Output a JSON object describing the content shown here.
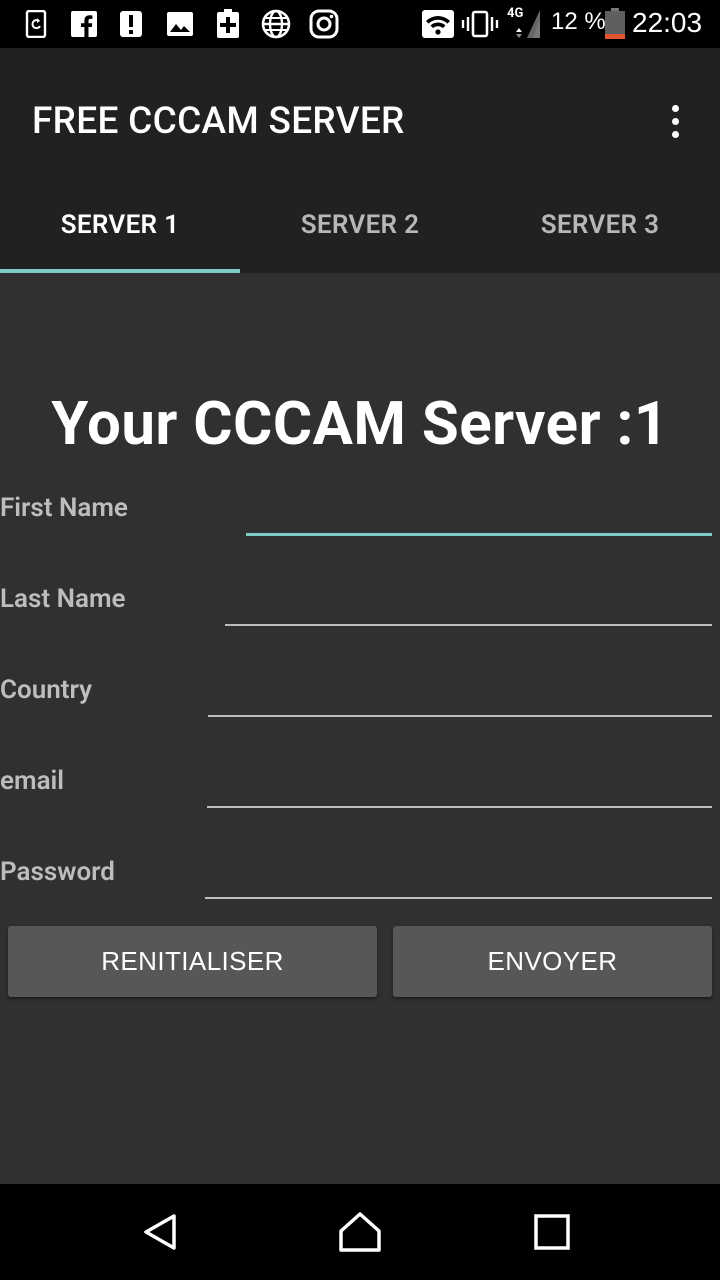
{
  "status_bar": {
    "battery_percent": "12 %",
    "time": "22:03",
    "network_type": "4G",
    "notification_icons": [
      "sync-app-icon",
      "facebook-icon",
      "alert-icon",
      "image-icon",
      "sim-plus-icon",
      "globe-icon",
      "instagram-icon"
    ]
  },
  "app_bar": {
    "title": "FREE CCCAM SERVER",
    "tabs": [
      {
        "label": "SERVER 1",
        "active": true
      },
      {
        "label": "SERVER 2",
        "active": false
      },
      {
        "label": "SERVER 3",
        "active": false
      }
    ]
  },
  "form": {
    "title": "Your CCCAM Server :1",
    "fields": [
      {
        "label": "First Name",
        "value": ""
      },
      {
        "label": "Last Name",
        "value": ""
      },
      {
        "label": "Country",
        "value": ""
      },
      {
        "label": "email",
        "value": ""
      },
      {
        "label": "Password",
        "value": ""
      }
    ],
    "reset_label": "RENITIALISER",
    "submit_label": "ENVOYER"
  },
  "colors": {
    "accent": "#80cbc4",
    "background": "#303030",
    "app_bar": "#212121",
    "button": "#575757"
  }
}
